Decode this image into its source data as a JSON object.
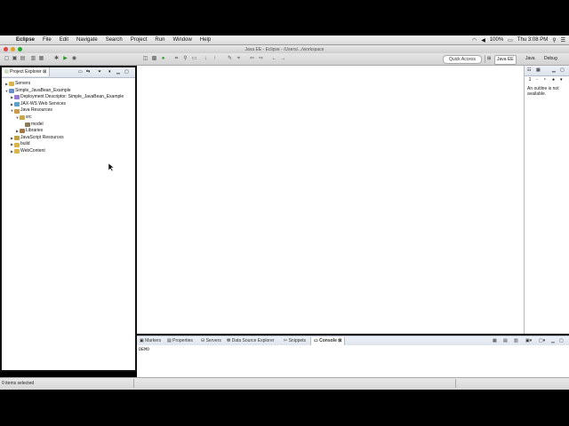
{
  "menubar": {
    "apple_icon": "apple-icon",
    "items": [
      "Eclipse",
      "File",
      "Edit",
      "Navigate",
      "Search",
      "Project",
      "Run",
      "Window",
      "Help"
    ],
    "battery": "100%",
    "clock": "Thu 3:08 PM"
  },
  "titlebar": {
    "title": "Java EE - Eclipse - /Users/.../workspace"
  },
  "toolbar": {
    "quick_access": "Quick Access",
    "perspectives": [
      "Java EE",
      "Java",
      "Debug"
    ]
  },
  "project_explorer": {
    "tab_label": "Project Explorer",
    "close_glyph": "⊠",
    "tree": [
      {
        "label": "Servers",
        "depth": 0,
        "expanded": false,
        "icon": "folder-icon"
      },
      {
        "label": "Simple_JavaBean_Example",
        "depth": 0,
        "expanded": true,
        "icon": "project-icon"
      },
      {
        "label": "Deployment Descriptor: Simple_JavaBean_Example",
        "depth": 1,
        "expanded": false,
        "icon": "descriptor-icon"
      },
      {
        "label": "JAX-WS Web Services",
        "depth": 1,
        "expanded": false,
        "icon": "webservice-icon"
      },
      {
        "label": "Java Resources",
        "depth": 1,
        "expanded": true,
        "icon": "java-resources-icon"
      },
      {
        "label": "src",
        "depth": 2,
        "expanded": true,
        "icon": "source-folder-icon"
      },
      {
        "label": "model",
        "depth": 3,
        "expanded": null,
        "icon": "package-icon"
      },
      {
        "label": "Libraries",
        "depth": 2,
        "expanded": false,
        "icon": "libraries-icon"
      },
      {
        "label": "JavaScript Resources",
        "depth": 1,
        "expanded": false,
        "icon": "js-resources-icon"
      },
      {
        "label": "build",
        "depth": 1,
        "expanded": false,
        "icon": "folder-icon"
      },
      {
        "label": "WebContent",
        "depth": 1,
        "expanded": false,
        "icon": "folder-icon"
      }
    ]
  },
  "outline": {
    "message": "An outline is not available."
  },
  "bottom_panel": {
    "tabs": [
      "Markers",
      "Properties",
      "Servers",
      "Data Source Explorer",
      "Snippets",
      "Console"
    ],
    "active_tab": "Console",
    "console_text": "DEMO"
  },
  "statusbar": {
    "text": "0 items selected"
  },
  "colors": {
    "menubar_bg": "#e4e4e4",
    "view_tab_bg": "#e5eaf2",
    "desktop_border": "#000000",
    "highlight_border": "#111111"
  }
}
